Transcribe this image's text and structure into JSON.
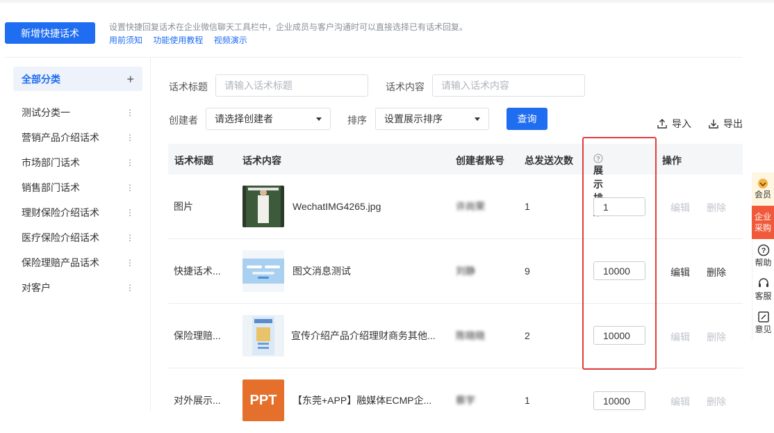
{
  "header": {
    "add_button": "新增快捷话术",
    "description": "设置快捷回复话术在企业微信聊天工具栏中，企业成员与客户沟通时可以直接选择已有话术回复。",
    "links": [
      "用前须知",
      "功能使用教程",
      "视频演示"
    ]
  },
  "sidebar": {
    "all_label": "全部分类",
    "add_icon": "+",
    "items": [
      {
        "label": "测试分类一"
      },
      {
        "label": "营销产品介绍话术"
      },
      {
        "label": "市场部门话术"
      },
      {
        "label": "销售部门话术"
      },
      {
        "label": "理财保险介绍话术"
      },
      {
        "label": "医疗保险介绍话术"
      },
      {
        "label": "保险理赔产品话术"
      },
      {
        "label": "对客户"
      }
    ],
    "more_icon": "⋮"
  },
  "filters": {
    "title_label": "话术标题",
    "title_placeholder": "请输入话术标题",
    "content_label": "话术内容",
    "content_placeholder": "请输入话术内容",
    "creator_label": "创建者",
    "creator_value": "请选择创建者",
    "sort_label": "排序",
    "sort_value": "设置展示排序",
    "query_button": "查询",
    "import_label": "导入",
    "export_label": "导出"
  },
  "table": {
    "columns": [
      "话术标题",
      "话术内容",
      "创建者账号",
      "总发送次数",
      "展示排序",
      "操作"
    ],
    "rows": [
      {
        "title": "图片",
        "content": "WechatIMG4265.jpg",
        "creator": "许尚荣",
        "sends": "1",
        "sort": "1",
        "edit": "编辑",
        "delete": "删除",
        "thumb": "photo"
      },
      {
        "title": "快捷话术...",
        "content": "图文消息测试",
        "creator": "刘静",
        "sends": "9",
        "sort": "10000",
        "edit": "编辑",
        "delete": "删除",
        "thumb": "web"
      },
      {
        "title": "保险理赔...",
        "content": "宣传介绍产品介绍理财商务其他...",
        "creator": "陈晓晓",
        "sends": "2",
        "sort": "10000",
        "edit": "编辑",
        "delete": "删除",
        "thumb": "poster"
      },
      {
        "title": "对外展示...",
        "content": "【东莞+APP】融媒体ECMP企...",
        "creator": "蔡宇",
        "sends": "1",
        "sort": "10000",
        "edit": "编辑",
        "delete": "删除",
        "thumb": "ppt",
        "thumb_text": "PPT"
      }
    ]
  },
  "float_bar": {
    "member": "会员",
    "buy": [
      "企业",
      "采购"
    ],
    "help": "帮助",
    "service": "客服",
    "feedback": "意见"
  },
  "colors": {
    "primary": "#1f6df0",
    "highlight_border": "#e23b3b",
    "disabled": "#c0c4cc"
  }
}
